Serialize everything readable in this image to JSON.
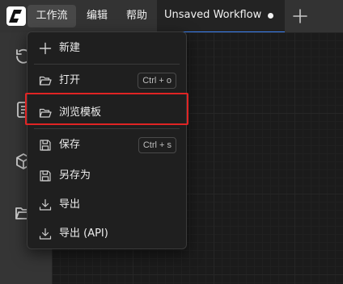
{
  "menubar": {
    "items": [
      {
        "label": "工作流"
      },
      {
        "label": "编辑"
      },
      {
        "label": "帮助"
      }
    ]
  },
  "tab": {
    "title": "Unsaved Workflow"
  },
  "sidebar": {
    "icons": [
      "history-icon",
      "queue-icon",
      "model-library-icon",
      "workflows-icon"
    ]
  },
  "dropdown": {
    "items": [
      {
        "label": "新建",
        "icon": "plus-icon",
        "shortcut": ""
      },
      {
        "label": "打开",
        "icon": "folder-open-icon",
        "shortcut": "Ctrl + o"
      },
      {
        "label": "浏览模板",
        "icon": "folder-open-icon",
        "shortcut": ""
      },
      {
        "label": "保存",
        "icon": "save-icon",
        "shortcut": "Ctrl + s"
      },
      {
        "label": "另存为",
        "icon": "save-icon",
        "shortcut": ""
      },
      {
        "label": "导出",
        "icon": "download-icon",
        "shortcut": ""
      },
      {
        "label": "导出 (API)",
        "icon": "download-icon",
        "shortcut": ""
      }
    ]
  },
  "colors": {
    "highlight": "#e02424",
    "tab_accent": "#3b82f6"
  }
}
